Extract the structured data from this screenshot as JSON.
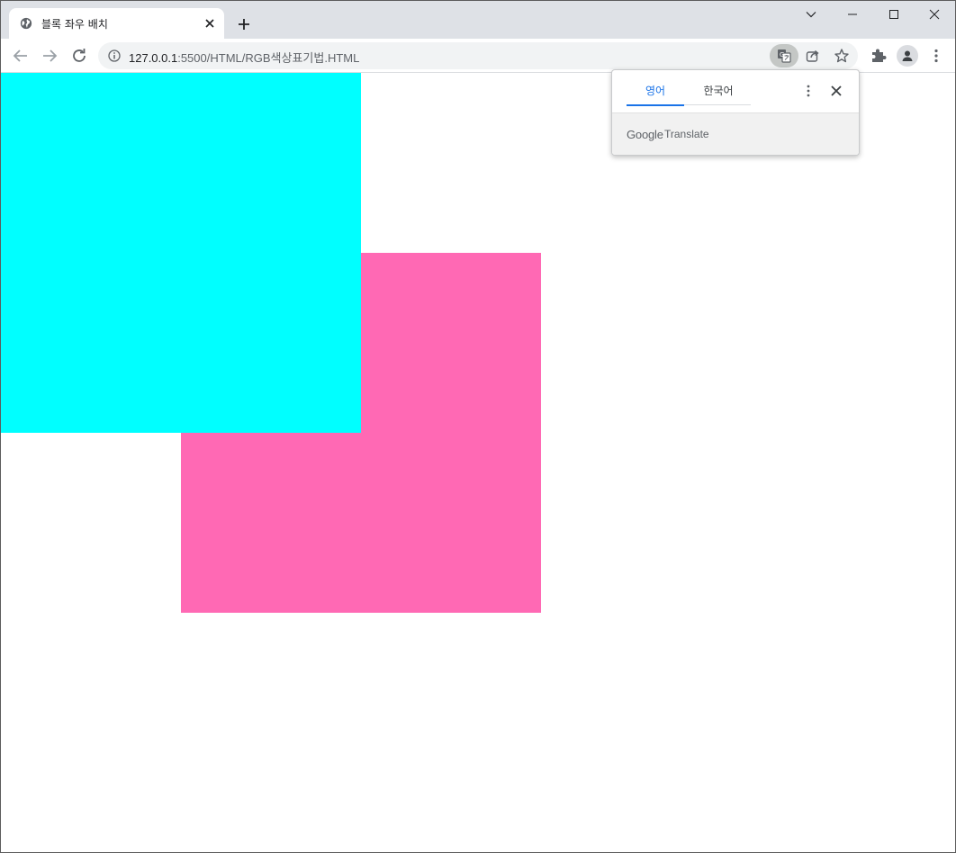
{
  "tab": {
    "title": "블록 좌우 배치"
  },
  "address_bar": {
    "host": "127.0.0.1",
    "path": ":5500/HTML/RGB색상표기법.HTML"
  },
  "boxes": [
    {
      "color": "#00ffff"
    },
    {
      "color": "#ff69b4"
    }
  ],
  "translate_popup": {
    "source_language": "영어",
    "target_language": "한국어",
    "brand_google": "Google",
    "brand_translate": "Translate"
  },
  "colors": {
    "tabstrip": "#dee1e6",
    "accent": "#1a73e8"
  }
}
